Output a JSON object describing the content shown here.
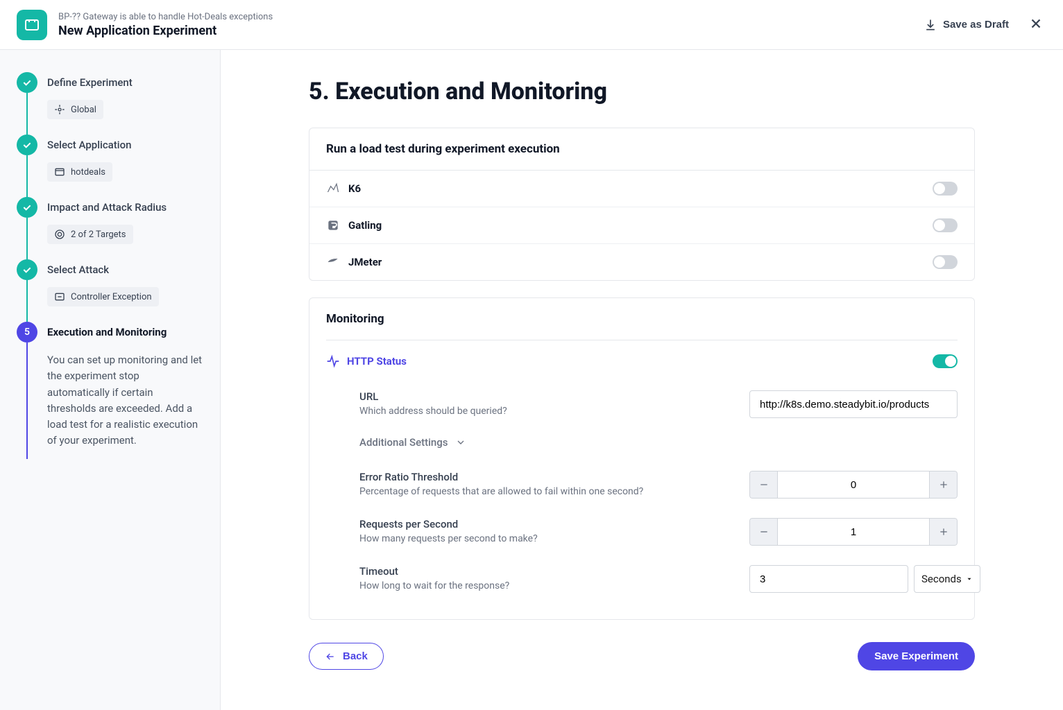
{
  "header": {
    "breadcrumb": "BP-?? Gateway is able to handle Hot-Deals exceptions",
    "title": "New Application Experiment",
    "save_draft_label": "Save as Draft"
  },
  "sidebar": {
    "steps": [
      {
        "label": "Define Experiment",
        "chip": "Global"
      },
      {
        "label": "Select Application",
        "chip": "hotdeals"
      },
      {
        "label": "Impact and Attack Radius",
        "chip": "2 of 2 Targets"
      },
      {
        "label": "Select Attack",
        "chip": "Controller Exception"
      },
      {
        "label": "Execution and Monitoring",
        "number": "5"
      }
    ],
    "current_desc": "You can set up monitoring and let the experiment stop automatically if certain thresholds are exceeded. Add a load test for a realistic execution of your experiment."
  },
  "main": {
    "heading": "5. Execution and Monitoring",
    "loadtest": {
      "title": "Run a load test during experiment execution",
      "tools": [
        {
          "name": "K6",
          "enabled": false
        },
        {
          "name": "Gatling",
          "enabled": false
        },
        {
          "name": "JMeter",
          "enabled": false
        }
      ]
    },
    "monitoring": {
      "title": "Monitoring",
      "http_status_label": "HTTP Status",
      "http_status_enabled": true,
      "url": {
        "label": "URL",
        "desc": "Which address should be queried?",
        "value": "http://k8s.demo.steadybit.io/products"
      },
      "additional_settings_label": "Additional Settings",
      "error_ratio": {
        "label": "Error Ratio Threshold",
        "desc": "Percentage of requests that are allowed to fail within one second?",
        "value": "0"
      },
      "rps": {
        "label": "Requests per Second",
        "desc": "How many requests per second to make?",
        "value": "1"
      },
      "timeout": {
        "label": "Timeout",
        "desc": "How long to wait for the response?",
        "value": "3",
        "unit": "Seconds"
      }
    },
    "footer": {
      "back_label": "Back",
      "save_label": "Save Experiment"
    }
  }
}
